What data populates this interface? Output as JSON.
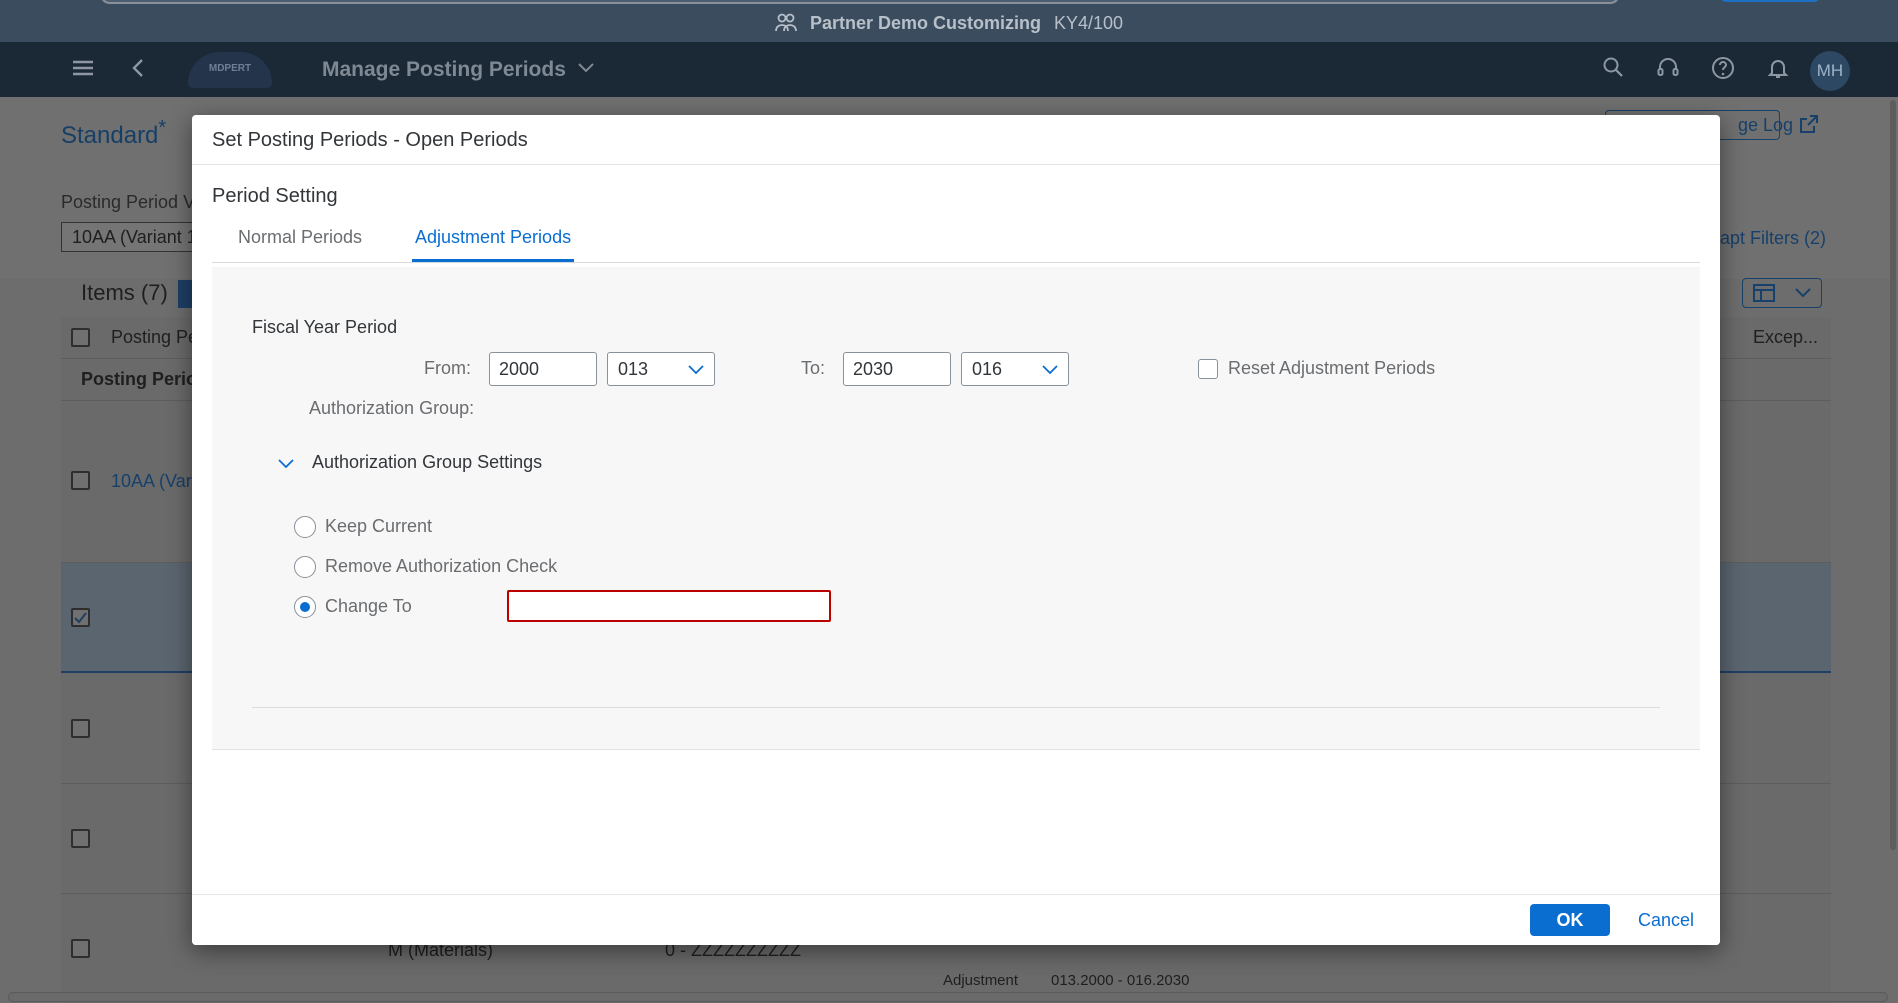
{
  "system_bar": {
    "title": "Partner Demo Customizing",
    "system_id": "KY4/100"
  },
  "shell": {
    "logo_text": "MDPERT",
    "app_title": "Manage Posting Periods",
    "avatar_initials": "MH"
  },
  "background": {
    "variant_title": "Standard",
    "variant_asterisk": "*",
    "filter_label": "Posting Period Va",
    "filter_value": "10AA (Variant 1",
    "change_log_link": "ge Log",
    "adapt_filters": "apt Filters (2)",
    "items_title": "Items (7)",
    "col_posting_period": "Posting Pe",
    "col_exceptions": "Excep...",
    "group_header": "Posting Perio",
    "row_link": "10AA (Vari",
    "row_materials": "M (Materials)",
    "row_range": "0 - ZZZZZZZZZZ",
    "row_adjustment_label": "Adjustment",
    "row_adjustment_value": "013.2000 - 016.2030"
  },
  "dialog": {
    "title": "Set Posting Periods - Open Periods",
    "section_title": "Period Setting",
    "tabs": [
      {
        "label": "Normal Periods",
        "active": false
      },
      {
        "label": "Adjustment Periods",
        "active": true
      }
    ],
    "fiscal_year_period_label": "Fiscal Year Period",
    "from_label": "From:",
    "from_year": "2000",
    "from_period": "013",
    "to_label": "To:",
    "to_year": "2030",
    "to_period": "016",
    "reset_label": "Reset Adjustment Periods",
    "auth_group_label": "Authorization Group:",
    "auth_settings_label": "Authorization Group Settings",
    "radio_options": [
      {
        "label": "Keep Current",
        "selected": false
      },
      {
        "label": "Remove Authorization Check",
        "selected": false
      },
      {
        "label": "Change To",
        "selected": true
      }
    ],
    "change_to_value": "",
    "ok_label": "OK",
    "cancel_label": "Cancel"
  },
  "colors": {
    "accent": "#0a6ed1",
    "error": "#bb0000",
    "shell_bg": "#1b2836"
  },
  "icons": [
    "menu-icon",
    "back-icon",
    "chevron-down-icon",
    "search-icon",
    "headset-icon",
    "help-icon",
    "bell-icon",
    "share-icon",
    "table-settings-icon",
    "people-icon"
  ]
}
